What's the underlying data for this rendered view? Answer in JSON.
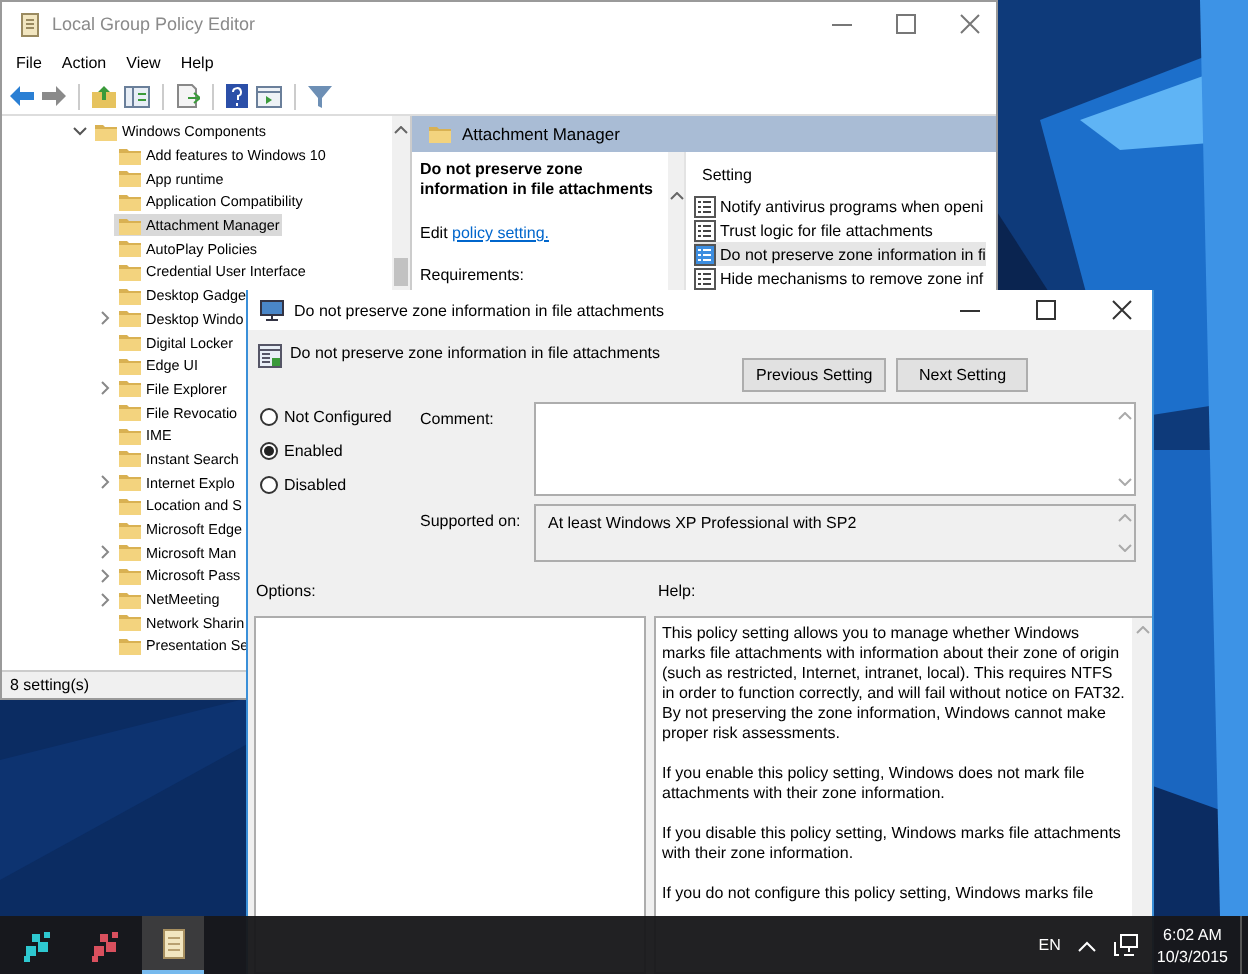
{
  "main_window": {
    "title": "Local Group Policy Editor",
    "menu": [
      "File",
      "Action",
      "View",
      "Help"
    ],
    "tree": [
      {
        "label": "Windows Components",
        "expanded": true,
        "selected": false,
        "children": [
          {
            "label": "Add features to Windows 10",
            "expandable": false,
            "selected": false
          },
          {
            "label": "App runtime",
            "expandable": false,
            "selected": false
          },
          {
            "label": "Application Compatibility",
            "expandable": false,
            "selected": false
          },
          {
            "label": "Attachment Manager",
            "expandable": false,
            "selected": true
          },
          {
            "label": "AutoPlay Policies",
            "expandable": false,
            "selected": false
          },
          {
            "label": "Credential User Interface",
            "expandable": false,
            "selected": false
          },
          {
            "label": "Desktop Gadge",
            "expandable": false,
            "selected": false
          },
          {
            "label": "Desktop Windo",
            "expandable": true,
            "selected": false
          },
          {
            "label": "Digital Locker",
            "expandable": false,
            "selected": false
          },
          {
            "label": "Edge UI",
            "expandable": false,
            "selected": false
          },
          {
            "label": "File Explorer",
            "expandable": true,
            "selected": false
          },
          {
            "label": "File Revocatio",
            "expandable": false,
            "selected": false
          },
          {
            "label": "IME",
            "expandable": false,
            "selected": false
          },
          {
            "label": "Instant Search",
            "expandable": false,
            "selected": false
          },
          {
            "label": "Internet Explo",
            "expandable": true,
            "selected": false
          },
          {
            "label": "Location and S",
            "expandable": false,
            "selected": false
          },
          {
            "label": "Microsoft Edge",
            "expandable": false,
            "selected": false
          },
          {
            "label": "Microsoft Man",
            "expandable": true,
            "selected": false
          },
          {
            "label": "Microsoft Pass",
            "expandable": true,
            "selected": false
          },
          {
            "label": "NetMeeting",
            "expandable": true,
            "selected": false
          },
          {
            "label": "Network Sharin",
            "expandable": false,
            "selected": false
          },
          {
            "label": "Presentation Se",
            "expandable": false,
            "selected": false
          }
        ]
      }
    ],
    "detail_header": "Attachment Manager",
    "description": {
      "title": "Do not preserve zone information in file attachments",
      "edit_text": "Edit",
      "edit_link": "policy setting.",
      "requirements_label": "Requirements:"
    },
    "settings_list": {
      "column": "Setting",
      "rows": [
        {
          "label": "Notify antivirus programs when openi",
          "selected": false
        },
        {
          "label": "Trust logic for file attachments",
          "selected": false
        },
        {
          "label": "Do not preserve zone information in fi",
          "selected": true
        },
        {
          "label": "Hide mechanisms to remove zone inf",
          "selected": false
        }
      ]
    },
    "status_bar": "8 setting(s)"
  },
  "dialog": {
    "title": "Do not preserve zone information in file attachments",
    "heading": "Do not preserve zone information in file attachments",
    "buttons": [
      "Previous Setting",
      "Next Setting"
    ],
    "options": [
      {
        "label": "Not Configured",
        "selected": false
      },
      {
        "label": "Enabled",
        "selected": true
      },
      {
        "label": "Disabled",
        "selected": false
      }
    ],
    "comment_label": "Comment:",
    "supported_label": "Supported on:",
    "supported_value": "At least Windows XP Professional with SP2",
    "options_label": "Options:",
    "help_label": "Help:",
    "help_paragraphs": [
      "This policy setting allows you to manage whether Windows marks file attachments with information about their zone of origin (such as restricted, Internet, intranet, local). This requires NTFS in order to function correctly, and will fail without notice on FAT32. By not preserving the zone information, Windows cannot make proper risk assessments.",
      "If you enable this policy setting, Windows does not mark file attachments with their zone information.",
      "If you disable this policy setting, Windows marks file attachments with their zone information.",
      "If you do not configure this policy setting, Windows marks file"
    ]
  },
  "taskbar": {
    "apps": [
      {
        "kind": "blocks",
        "color": "#2ec8d0",
        "selected": false
      },
      {
        "kind": "blocks",
        "color": "#d9505e",
        "selected": false
      },
      {
        "kind": "scroll",
        "selected": true
      }
    ],
    "language": "EN",
    "time": "6:02 AM",
    "date": "10/3/2015"
  }
}
